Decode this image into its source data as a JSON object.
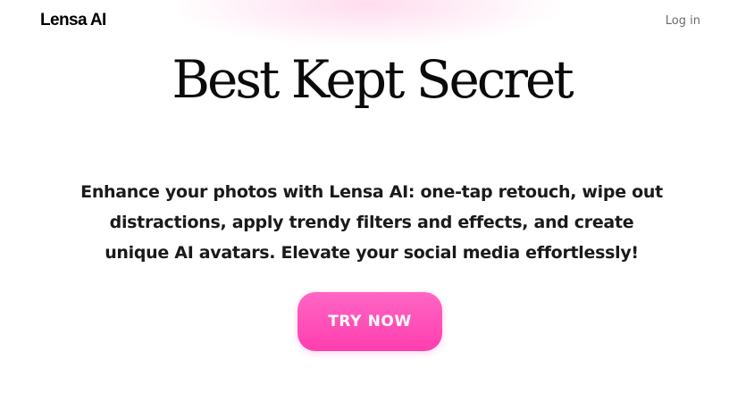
{
  "header": {
    "brand": "Lensa AI",
    "login_label": "Log in"
  },
  "hero": {
    "title": "Best Kept Secret",
    "description": "Enhance your photos with Lensa AI: one-tap retouch, wipe out distractions, apply trendy filters and effects, and create unique AI avatars. Elevate your social media effortlessly!",
    "cta_label": "TRY NOW"
  },
  "colors": {
    "cta_gradient_top": "#ff66c4",
    "cta_gradient_bottom": "#ff3eaf",
    "text": "#111111",
    "login_text": "#6b6b6b",
    "background": "#ffffff"
  }
}
